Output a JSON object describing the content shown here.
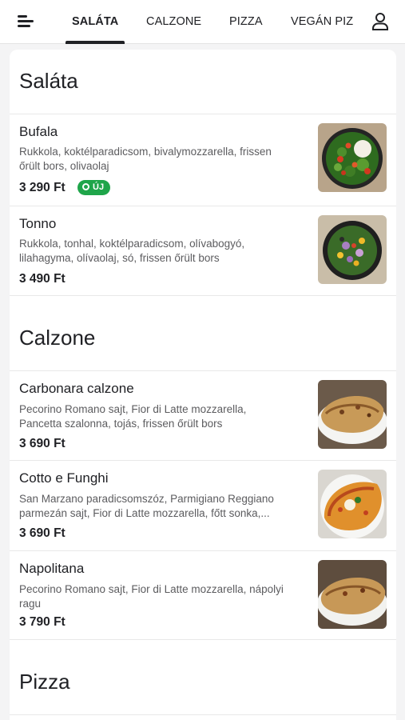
{
  "nav": {
    "menu_icon": "hamburger-icon",
    "user_icon": "user-icon",
    "tabs": [
      {
        "label": "SALÁTA",
        "active": true
      },
      {
        "label": "CALZONE",
        "active": false
      },
      {
        "label": "PIZZA",
        "active": false
      },
      {
        "label": "VEGÁN PIZ",
        "active": false
      }
    ]
  },
  "sections": [
    {
      "title": "Saláta",
      "items": [
        {
          "name": "Bufala",
          "description": [
            "Rukkola, koktélparadicsom, bivalymozzarella, frissen",
            "őrült bors, olivaolaj"
          ],
          "price": "3 290 Ft",
          "badge": "ÚJ"
        },
        {
          "name": "Tonno",
          "description": [
            "Rukkola, tonhal, koktélparadicsom, olívabogyó,",
            "lilahagyma, olívaolaj, só, frissen őrült bors"
          ],
          "price": "3 490 Ft"
        }
      ]
    },
    {
      "title": "Calzone",
      "items": [
        {
          "name": "Carbonara calzone",
          "description": [
            "Pecorino Romano sajt, Fior di Latte mozzarella,",
            "Pancetta szalonna, tojás, frissen őrült bors"
          ],
          "price": "3 690 Ft"
        },
        {
          "name": "Cotto e Funghi",
          "description": [
            "San Marzano paradicsomszóz, Parmigiano Reggiano",
            "parmezán sajt, Fior di Latte mozzarella, főtt sonka,..."
          ],
          "price": "3 690 Ft"
        },
        {
          "name": "Napolitana",
          "description": [
            "Pecorino Romano sajt, Fior di Latte mozzarella, nápolyi",
            "ragu"
          ],
          "price": "3 790 Ft"
        }
      ]
    },
    {
      "title": "Pizza",
      "items": []
    }
  ],
  "colors": {
    "badge_green": "#1fa54a",
    "text": "#202125",
    "muted": "#5c5c5f",
    "background": "#f4f4f5"
  }
}
